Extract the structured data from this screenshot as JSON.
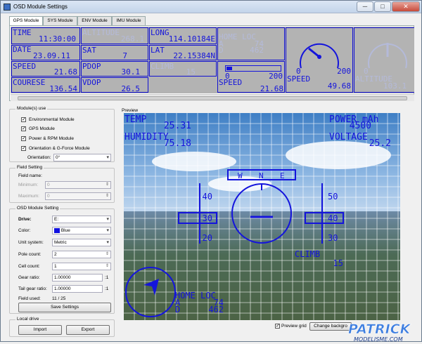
{
  "window": {
    "title": "OSD Module Settings",
    "min": "─",
    "max": "□",
    "close": "✕"
  },
  "tabs": [
    "GPS Module",
    "SYS Module",
    "ENV Module",
    "IMU Module"
  ],
  "gps_panel": {
    "time_label": "TIME",
    "time_value": "11:30:00",
    "altitude_label": "ALTITUDE",
    "altitude_value": "268.1",
    "long_label": "LONG",
    "long_value": "114.10184E",
    "homeloc_label": "HOME LOC",
    "homeloc_a": "A",
    "homeloc_a_val": "74",
    "homeloc_d": "D",
    "homeloc_d_val": "462",
    "date_label": "DATE",
    "date_value": "23.09.11",
    "sat_label": "SAT",
    "sat_value": "7",
    "lat_label": "LAT",
    "lat_value": "22.15384N",
    "speed_label": "SPEED",
    "speed_value": "21.68",
    "pdop_label": "PDOP",
    "pdop_value": "30.1",
    "climb_label": "CLIMB",
    "climb_value": "15",
    "course_label": "COURESE",
    "course_value": "136.54",
    "vdop_label": "VDOP",
    "vdop_value": "26.5",
    "bar_min": "0",
    "bar_max": "200",
    "bar_label": "SPEED",
    "bar_value": "21.68",
    "gauge_min": "0",
    "gauge_max": "200",
    "gauge_label": "SPEED",
    "gauge_value": "49.68",
    "gauge2_min": "0",
    "gauge2_label": "ALTITUDE",
    "gauge2_value": "103.1"
  },
  "modules": {
    "title": "Module(s) use",
    "items": [
      "Environmental Module",
      "GPS Module",
      "Power & RPM Module",
      "Orientation & G-Force Module"
    ],
    "orientation_label": "Orientation:",
    "orientation_value": "0°"
  },
  "field_setting": {
    "title": "Field Setting",
    "name_label": "Field name:",
    "min_label": "Minimum:",
    "min_value": "0",
    "max_label": "Maximum:",
    "max_value": "0"
  },
  "osd_setting": {
    "title": "OSD Module Setting",
    "drive_label": "Drive:",
    "drive_value": "E:",
    "color_label": "Color:",
    "color_value": "Blue",
    "color_swatch": "#1010e0",
    "unit_label": "Unit system:",
    "unit_value": "Metric",
    "pole_label": "Pole count:",
    "pole_value": "2",
    "cell_label": "Cell count:",
    "cell_value": "1",
    "gear_label": "Gear ratio:",
    "gear_value": "1.00000",
    "gear_suffix": ":1",
    "tail_label": "Tail gear ratio:",
    "tail_value": "1.00000",
    "tail_suffix": ":1",
    "used_label": "Field used:",
    "used_value": "11 / 25",
    "save_button": "Save Settings"
  },
  "local_drive": {
    "title": "Local drive",
    "import_button": "Import",
    "export_button": "Export"
  },
  "preview": {
    "title": "Preview",
    "temp_label": "TEMP",
    "temp_value": "25.31",
    "humidity_label": "HUMIDITY",
    "humidity_value": "75.18",
    "power_label": "POWER mAh",
    "power_value": "4500",
    "voltage_label": "VOLTAGE",
    "voltage_value": "25.2",
    "compass_w": "W",
    "compass_n": "N",
    "compass_e": "E",
    "left_ticks": [
      "40",
      "30",
      "20"
    ],
    "right_ticks": [
      "50",
      "40",
      "30"
    ],
    "left_box": "30",
    "right_box": "40",
    "climb_label": "CLIMB",
    "climb_value": "15",
    "homeloc_label": "HOME LOC",
    "homeloc_a": "A",
    "homeloc_a_val": "74",
    "homeloc_d": "D",
    "homeloc_d_val": "462",
    "preview_grid_label": "Preview grid",
    "change_bg_button": "Change backgro",
    "accent": "#1414dc"
  },
  "watermark": {
    "brand": "PATRICK",
    "site": "MODELISME.COM"
  }
}
